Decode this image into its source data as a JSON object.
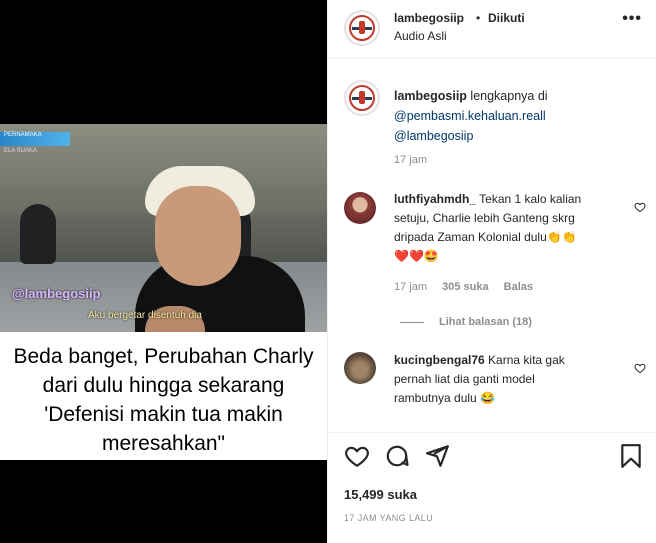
{
  "media": {
    "tag": "PERNAMAKA",
    "tag_sub": "ELA SUAKA",
    "watermark": "@lambegosiip",
    "subtitle": "Aku bergetar disentuh dia",
    "caption_lines": [
      "Beda banget, Perubahan Charly",
      "dari dulu hingga sekarang",
      "'Defenisi makin tua makin",
      "meresahkan\""
    ]
  },
  "header": {
    "username": "lambegosiip",
    "dot": "•",
    "follow_status": "Diikuti",
    "audio": "Audio Asli",
    "more_icon": "more-horizontal-icon"
  },
  "post_caption": {
    "username": "lambegosiip",
    "text": "lengkapnya di",
    "mention1": "@pembasmi.kehaluan.reall",
    "mention2": "@lambegosiip",
    "time": "17 jam"
  },
  "comments": [
    {
      "username": "luthfiyahmdh_",
      "text_line1": "Tekan 1 kalo kalian",
      "text_line2": "setuju, Charlie lebih Ganteng skrg",
      "text_line3": "dripada Zaman Kolonial dulu",
      "emoji_inline": "👏👏",
      "emoji_line": "❤️❤️🤩",
      "time": "17 jam",
      "likes": "305 suka",
      "reply": "Balas",
      "view_replies": "Lihat balasan (18)"
    },
    {
      "username": "kucingbengal76",
      "text_line1": "Karna kita gak",
      "text_line2": "pernah liat dia ganti model",
      "text_line3": "rambutnya dulu",
      "emoji_inline": "😂"
    }
  ],
  "actions": {
    "like_icon": "heart-icon",
    "comment_icon": "comment-icon",
    "share_icon": "share-icon",
    "save_icon": "bookmark-icon",
    "likes_count": "15,499 suka",
    "posted_ago": "17 JAM YANG LALU"
  }
}
